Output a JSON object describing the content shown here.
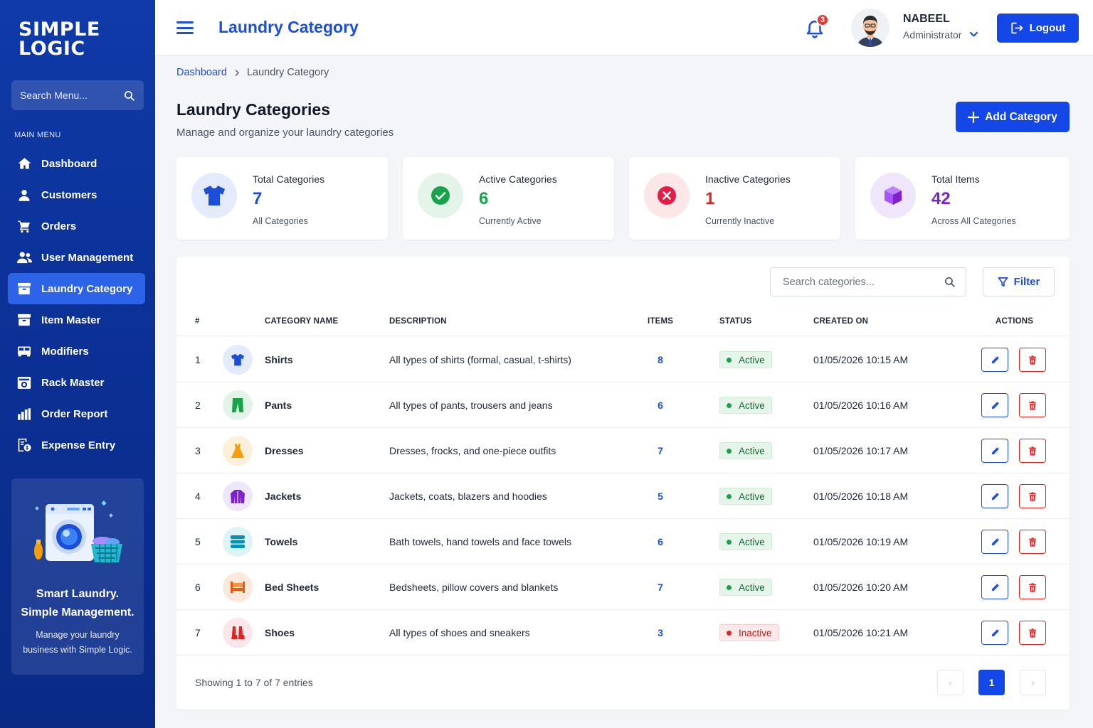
{
  "brand": {
    "line1": "SIMPLE",
    "line2": "LOGIC"
  },
  "sidebar": {
    "search_placeholder": "Search Menu...",
    "section_label": "MAIN MENU",
    "items": [
      {
        "label": "Dashboard",
        "icon": "home-icon",
        "active": false
      },
      {
        "label": "Customers",
        "icon": "user-icon",
        "active": false
      },
      {
        "label": "Orders",
        "icon": "cart-icon",
        "active": false
      },
      {
        "label": "User Management",
        "icon": "users-icon",
        "active": false
      },
      {
        "label": "Laundry Category",
        "icon": "box-icon",
        "active": true
      },
      {
        "label": "Item Master",
        "icon": "box-icon",
        "active": false
      },
      {
        "label": "Modifiers",
        "icon": "van-icon",
        "active": false
      },
      {
        "label": "Rack Master",
        "icon": "rack-icon",
        "active": false
      },
      {
        "label": "Order Report",
        "icon": "bar-chart-icon",
        "active": false
      },
      {
        "label": "Expense Entry",
        "icon": "receipt-icon",
        "active": false
      }
    ],
    "promo": {
      "title_line1": "Smart Laundry.",
      "title_line2": "Simple Management.",
      "text": "Manage your laundry business with Simple Logic."
    }
  },
  "header": {
    "title": "Laundry Category",
    "notification_count": "3",
    "user_name": "NABEEL",
    "user_role": "Administrator",
    "logout_label": "Logout"
  },
  "breadcrumb": {
    "home": "Dashboard",
    "current": "Laundry Category"
  },
  "page": {
    "title": "Laundry Categories",
    "subtitle": "Manage and organize your laundry categories",
    "add_label": "Add Category"
  },
  "stats": [
    {
      "label": "Total Categories",
      "value": "7",
      "note": "All Categories",
      "color": "#1d4ed8"
    },
    {
      "label": "Active Categories",
      "value": "6",
      "note": "Currently Active",
      "color": "#16a34a"
    },
    {
      "label": "Inactive Categories",
      "value": "1",
      "note": "Currently Inactive",
      "color": "#dc2626"
    },
    {
      "label": "Total Items",
      "value": "42",
      "note": "Across All Categories",
      "color": "#7e22ce"
    }
  ],
  "table": {
    "search_placeholder": "Search categories...",
    "filter_label": "Filter",
    "columns": [
      "#",
      "CATEGORY NAME",
      "DESCRIPTION",
      "ITEMS",
      "STATUS",
      "CREATED ON",
      "ACTIONS"
    ],
    "rows": [
      {
        "num": "1",
        "name": "Shirts",
        "description": "All types of shirts (formal, casual, t-shirts)",
        "items": "8",
        "status": "Active",
        "created": "01/05/2026 10:15 AM",
        "icon": "shirt-icon"
      },
      {
        "num": "2",
        "name": "Pants",
        "description": "All types of pants, trousers and jeans",
        "items": "6",
        "status": "Active",
        "created": "01/05/2026 10:16 AM",
        "icon": "pants-icon"
      },
      {
        "num": "3",
        "name": "Dresses",
        "description": "Dresses, frocks, and one-piece outfits",
        "items": "7",
        "status": "Active",
        "created": "01/05/2026 10:17 AM",
        "icon": "dress-icon"
      },
      {
        "num": "4",
        "name": "Jackets",
        "description": "Jackets, coats, blazers and hoodies",
        "items": "5",
        "status": "Active",
        "created": "01/05/2026 10:18 AM",
        "icon": "jacket-icon"
      },
      {
        "num": "5",
        "name": "Towels",
        "description": "Bath towels, hand towels and face towels",
        "items": "6",
        "status": "Active",
        "created": "01/05/2026 10:19 AM",
        "icon": "towel-icon"
      },
      {
        "num": "6",
        "name": "Bed Sheets",
        "description": "Bedsheets, pillow covers and blankets",
        "items": "7",
        "status": "Active",
        "created": "01/05/2026 10:20 AM",
        "icon": "bed-icon"
      },
      {
        "num": "7",
        "name": "Shoes",
        "description": "All types of shoes and sneakers",
        "items": "3",
        "status": "Inactive",
        "created": "01/05/2026 10:21 AM",
        "icon": "shoe-icon"
      }
    ],
    "footer": "Showing 1 to 7 of 7 entries",
    "pagination": {
      "prev": "‹",
      "current": "1",
      "next": "›"
    }
  }
}
